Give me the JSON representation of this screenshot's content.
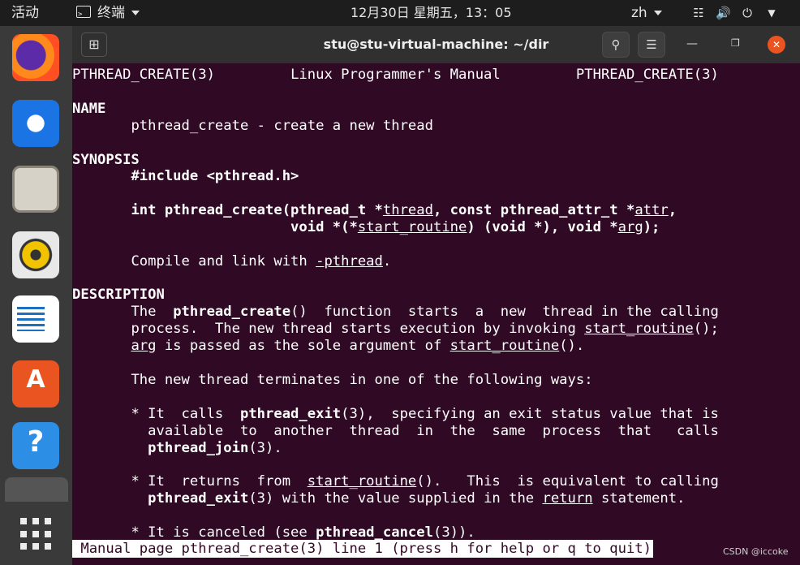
{
  "topbar": {
    "activities": "活动",
    "app_name": "终端",
    "clock": "12月30日 星期五，13：05",
    "language": "zh",
    "icons": [
      "network-icon",
      "volume-icon",
      "power-icon",
      "chevron-down-icon"
    ]
  },
  "dock": {
    "apps": [
      "firefox-icon",
      "thunderbird-icon",
      "files-icon",
      "rhythmbox-icon",
      "libreoffice-writer-icon",
      "ubuntu-software-icon",
      "help-icon",
      "terminal-icon",
      "show-applications-icon"
    ]
  },
  "window": {
    "title": "stu@stu-virtual-machine: ~/dir"
  },
  "manpage": {
    "header_left": "PTHREAD_CREATE(3)",
    "header_center": "Linux Programmer's Manual",
    "header_right": "PTHREAD_CREATE(3)",
    "name_heading": "NAME",
    "name_text": "pthread_create - create a new thread",
    "synopsis_heading": "SYNOPSIS",
    "include": "#include <pthread.h>",
    "proto1_a": "int pthread_create(pthread_t *",
    "proto1_thread": "thread",
    "proto1_b": ", const pthread_attr_t *",
    "proto1_attr": "attr",
    "proto1_c": ",",
    "proto2_a": "void *(*",
    "proto2_start": "start_routine",
    "proto2_b": ") (void *), void *",
    "proto2_arg": "arg",
    "proto2_c": ");",
    "link_a": "Compile and link with ",
    "link_flag": "-pthread",
    "link_c": ".",
    "description_heading": "DESCRIPTION",
    "d1_a": "The  ",
    "d1_func": "pthread_create",
    "d1_b": "()  function  starts  a  new  thread in the calling",
    "d2_a": "process.  The new thread starts execution by invoking ",
    "d2_sr": "start_routine",
    "d2_b": "();",
    "d3_arg": "arg",
    "d3_a": " is passed as the sole argument of ",
    "d3_sr": "start_routine",
    "d3_b": "().",
    "d4": "The new thread terminates in one of the following ways:",
    "b1_a": "* It  calls  ",
    "b1_func": "pthread_exit",
    "b1_b": "(3),  specifying an exit status value that is",
    "b1_l2": "available  to  another  thread  in  the  same  process  that   calls",
    "b1_func2": "pthread_join",
    "b1_l3b": "(3).",
    "b2_a": "* It  returns  from  ",
    "b2_sr": "start_routine",
    "b2_b": "().   This  is equivalent to calling",
    "b2_func": "pthread_exit",
    "b2_c": "(3) with the value supplied in the ",
    "b2_ret": "return",
    "b2_d": " statement.",
    "b3_a": "* It is canceled (see ",
    "b3_func": "pthread_cancel",
    "b3_b": "(3))."
  },
  "status_line": " Manual page pthread_create(3) line 1 (press h for help or q to quit)",
  "watermark": "CSDN @iccoke"
}
